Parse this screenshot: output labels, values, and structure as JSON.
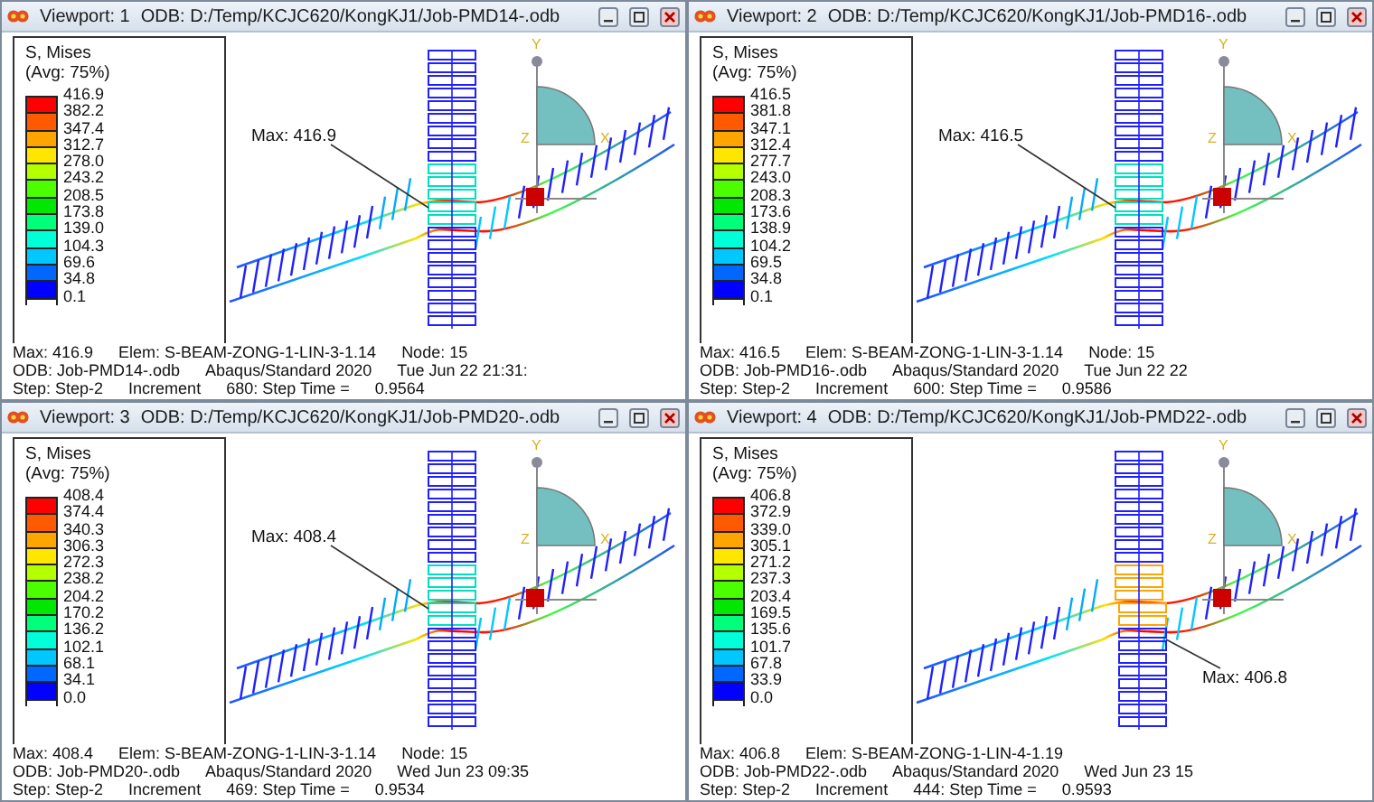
{
  "viewports": [
    {
      "label": "Viewport: 1",
      "odb_path": "ODB: D:/Temp/KCJC620/KongKJ1/Job-PMD14-.odb",
      "legend": {
        "title": "S, Mises",
        "subtitle": "(Avg: 75%)",
        "values": [
          "416.9",
          "382.2",
          "347.4",
          "312.7",
          "278.0",
          "243.2",
          "208.5",
          "173.8",
          "139.0",
          "104.3",
          "69.6",
          "34.8",
          "0.1"
        ]
      },
      "max_callout": {
        "text": "Max: 416.9",
        "kind": "left"
      },
      "max_summary": "Max: 416.9",
      "elem": "Elem: S-BEAM-ZONG-1-LIN-3-1.14",
      "node": "Node: 15",
      "odb": "ODB: Job-PMD14-.odb",
      "solver": "Abaqus/Standard 2020",
      "date": "Tue Jun 22 21:31:",
      "step": "Step: Step-2",
      "increment": "Increment",
      "increment_info": "680: Step Time =",
      "step_time": "0.9564",
      "triad": {
        "y": "Y",
        "x": "X",
        "z": "Z"
      }
    },
    {
      "label": "Viewport: 2",
      "odb_path": "ODB: D:/Temp/KCJC620/KongKJ1/Job-PMD16-.odb",
      "legend": {
        "title": "S, Mises",
        "subtitle": "(Avg: 75%)",
        "values": [
          "416.5",
          "381.8",
          "347.1",
          "312.4",
          "277.7",
          "243.0",
          "208.3",
          "173.6",
          "138.9",
          "104.2",
          "69.5",
          "34.8",
          "0.1"
        ]
      },
      "max_callout": {
        "text": "Max: 416.5",
        "kind": "left"
      },
      "max_summary": "Max: 416.5",
      "elem": "Elem: S-BEAM-ZONG-1-LIN-3-1.14",
      "node": "Node: 15",
      "odb": "ODB: Job-PMD16-.odb",
      "solver": "Abaqus/Standard 2020",
      "date": "Tue Jun 22 22",
      "step": "Step: Step-2",
      "increment": "Increment",
      "increment_info": "600: Step Time =",
      "step_time": "0.9586",
      "triad": {
        "y": "Y",
        "x": "X",
        "z": "Z"
      }
    },
    {
      "label": "Viewport: 3",
      "odb_path": "ODB: D:/Temp/KCJC620/KongKJ1/Job-PMD20-.odb",
      "legend": {
        "title": "S, Mises",
        "subtitle": "(Avg: 75%)",
        "values": [
          "408.4",
          "374.4",
          "340.3",
          "306.3",
          "272.3",
          "238.2",
          "204.2",
          "170.2",
          "136.2",
          "102.1",
          "68.1",
          "34.1",
          "0.0"
        ]
      },
      "max_callout": {
        "text": "Max: 408.4",
        "kind": "left"
      },
      "max_summary": "Max: 408.4",
      "elem": "Elem: S-BEAM-ZONG-1-LIN-3-1.14",
      "node": "Node: 15",
      "odb": "ODB: Job-PMD20-.odb",
      "solver": "Abaqus/Standard 2020",
      "date": "Wed Jun 23 09:35",
      "step": "Step: Step-2",
      "increment": "Increment",
      "increment_info": "469: Step Time =",
      "step_time": "0.9534",
      "triad": {
        "y": "Y",
        "x": "X",
        "z": "Z"
      }
    },
    {
      "label": "Viewport: 4",
      "odb_path": "ODB: D:/Temp/KCJC620/KongKJ1/Job-PMD22-.odb",
      "legend": {
        "title": "S, Mises",
        "subtitle": "(Avg: 75%)",
        "values": [
          "406.8",
          "372.9",
          "339.0",
          "305.1",
          "271.2",
          "237.3",
          "203.4",
          "169.5",
          "135.6",
          "101.7",
          "67.8",
          "33.9",
          "0.0"
        ]
      },
      "max_callout": {
        "text": "Max: 406.8",
        "kind": "right"
      },
      "max_summary": "Max: 406.8",
      "elem": "Elem: S-BEAM-ZONG-1-LIN-4-1.19",
      "odb": "ODB: Job-PMD22-.odb",
      "solver": "Abaqus/Standard 2020",
      "date": "Wed Jun 23 15",
      "step": "Step: Step-2",
      "increment": "Increment",
      "increment_info": "444: Step Time =",
      "step_time": "0.9593",
      "triad": {
        "y": "Y",
        "x": "X",
        "z": "Z"
      }
    }
  ]
}
